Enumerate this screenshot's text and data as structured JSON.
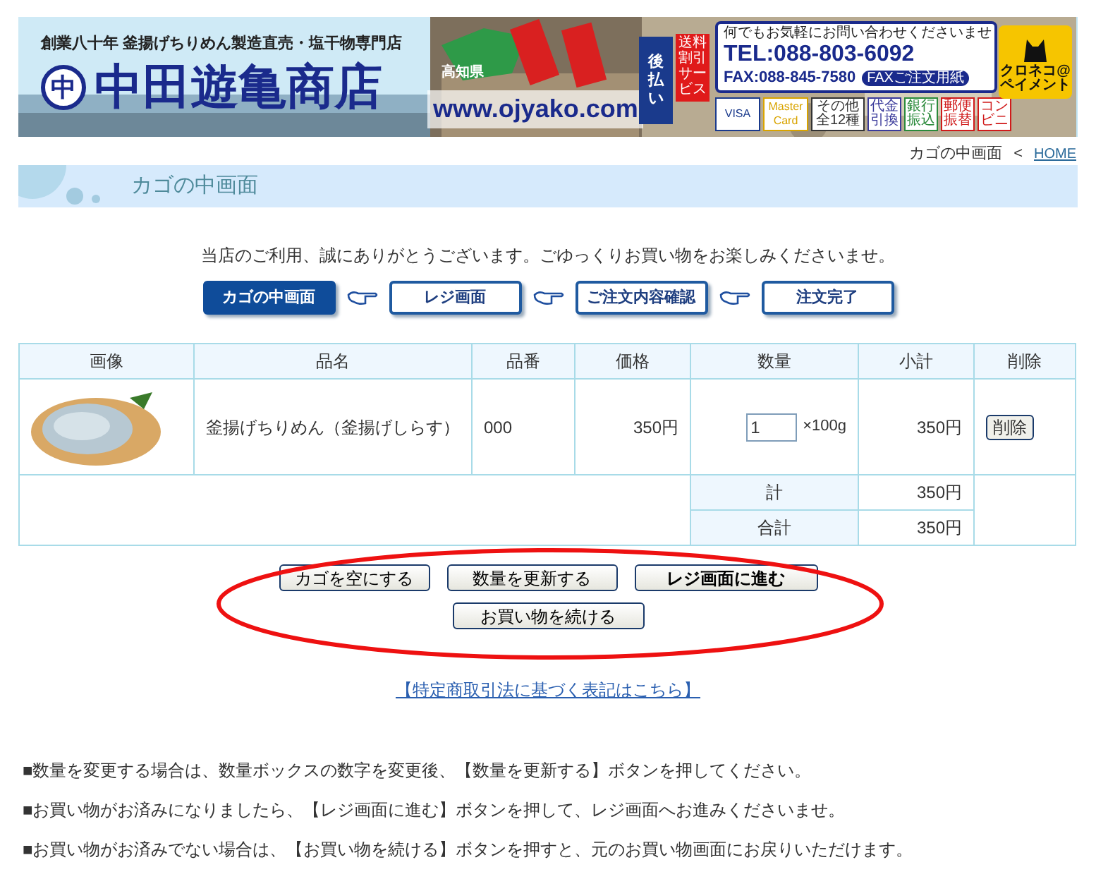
{
  "banner": {
    "tagline": "創業八十年 釜揚げちりめん製造直売・塩干物専門店",
    "logo_mark": "中",
    "shop_name": "中田遊亀商店",
    "prefecture": "高知県",
    "url": "www.ojyako.com",
    "deferred": "後払い",
    "shipping": "送料割引サービス",
    "contact_note": "何でもお気軽にお問い合わせくださいませ",
    "tel": "TEL:088-803-6092",
    "fax": "FAX:088-845-7580",
    "fax_badge": "FAXご注文用紙",
    "payments": [
      {
        "label": "VISA",
        "color": "#1a3a8c"
      },
      {
        "label": "MasterCard",
        "color": "#d9a400"
      },
      {
        "label": "その他全12種",
        "color": "#333333"
      },
      {
        "label": "代金引換",
        "color": "#3b3b9b"
      },
      {
        "label": "銀行振込",
        "color": "#2a8a3a"
      },
      {
        "label": "郵便振替",
        "color": "#d01a1a"
      },
      {
        "label": "コンビニ",
        "color": "#d01a1a"
      }
    ],
    "yamato": "クロネコ@ペイメント"
  },
  "breadcrumb": {
    "current": "カゴの中画面",
    "separator": "<",
    "home": "HOME"
  },
  "page_title": "カゴの中画面",
  "intro": "当店のご利用、誠にありがとうございます。ごゆっくりお買い物をお楽しみくださいませ。",
  "steps": [
    {
      "label": "カゴの中画面",
      "selected": true
    },
    {
      "label": "レジ画面",
      "selected": false
    },
    {
      "label": "ご注文内容確認",
      "selected": false
    },
    {
      "label": "注文完了",
      "selected": false
    }
  ],
  "table": {
    "columns": [
      "画像",
      "品名",
      "品番",
      "価格",
      "数量",
      "小計",
      "削除"
    ],
    "rows": [
      {
        "name": "釜揚げちりめん（釜揚げしらす）",
        "code": "000",
        "price": "350円",
        "quantity": "1",
        "unit": "×100g",
        "subtotal": "350円",
        "delete": "削除"
      }
    ],
    "totals": [
      {
        "label": "計",
        "value": "350円"
      },
      {
        "label": "合計",
        "value": "350円"
      }
    ]
  },
  "actions": [
    {
      "label": "カゴを空にする",
      "bold": false
    },
    {
      "label": "数量を更新する",
      "bold": false
    },
    {
      "label": "レジ画面に進む",
      "bold": true
    },
    {
      "label": "お買い物を続ける",
      "bold": false
    }
  ],
  "legal_link": "【特定商取引法に基づく表記はこちら】",
  "notes": [
    "■数量を変更する場合は、数量ボックスの数字を変更後、【数量を更新する】ボタンを押してください。",
    "■お買い物がお済みになりましたら、【レジ画面に進む】ボタンを押して、レジ画面へお進みくださいませ。",
    "■お買い物がお済みでない場合は、【お買い物を続ける】ボタンを押すと、元のお買い物画面にお戻りいただけます。"
  ]
}
